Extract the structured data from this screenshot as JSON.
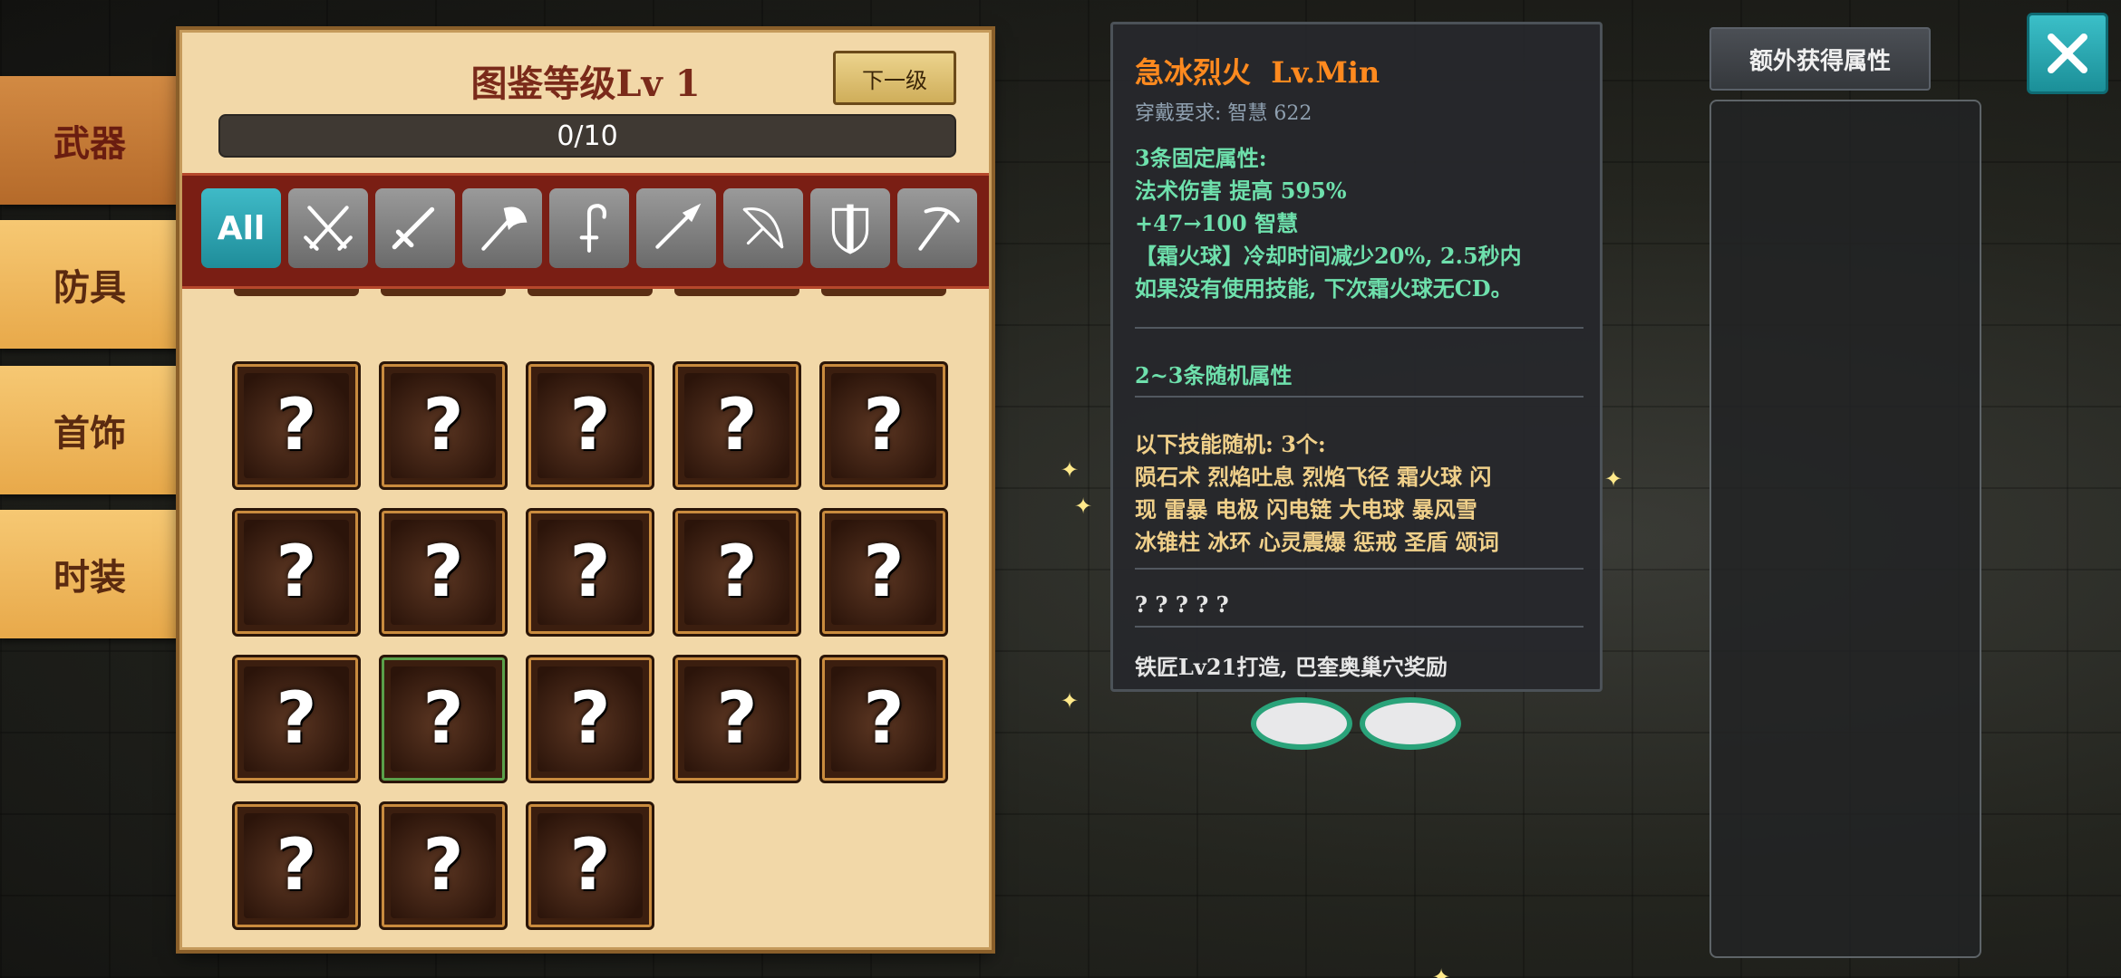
{
  "tabs": [
    {
      "label": "武器",
      "active": true
    },
    {
      "label": "防具",
      "active": false
    },
    {
      "label": "首饰",
      "active": false
    },
    {
      "label": "时装",
      "active": false
    }
  ],
  "codex": {
    "title": "图鉴等级Lv 1",
    "next_button": "下一级",
    "progress_text": "0/10",
    "progress_fraction": 0
  },
  "filters": [
    {
      "label": "All",
      "icon": "all-icon",
      "active": true
    },
    {
      "icon": "dual-swords-icon"
    },
    {
      "icon": "sword-icon"
    },
    {
      "icon": "axe-icon"
    },
    {
      "icon": "hook-icon"
    },
    {
      "icon": "spear-icon"
    },
    {
      "icon": "bow-icon"
    },
    {
      "icon": "shield-sword-icon"
    },
    {
      "icon": "scythe-icon"
    }
  ],
  "grid": {
    "slot_text": "?",
    "slots": [
      {
        "icon": "shield-icon"
      },
      {
        "icon": "axe-icon"
      },
      {
        "icon": "spear-icon"
      },
      {
        "icon": "scythe-icon"
      },
      {
        "icon": "crescent-blade-icon"
      },
      {
        "icon": "battle-axe-icon"
      },
      {
        "icon": "staff-icon"
      },
      {
        "icon": "armor-icon"
      },
      {
        "icon": "hammer-icon"
      },
      {
        "icon": "halberd-icon"
      },
      {
        "icon": "sickle-icon"
      },
      {
        "icon": "mace-icon",
        "selected": true
      },
      {
        "icon": "greatsword-icon"
      },
      {
        "icon": "scythe-icon"
      },
      {
        "icon": "glaive-icon"
      },
      {
        "icon": "spiked-shield-icon"
      },
      {
        "icon": "crescent-spear-icon"
      },
      {
        "icon": "blade-icon"
      }
    ]
  },
  "tooltip": {
    "name": "急冰烈火",
    "level": "Lv.Min",
    "requirement_label": "穿戴要求:",
    "requirement_value": "智慧 622",
    "fixed_header": "3条固定属性:",
    "fixed_lines": [
      "法术伤害 提高 595%",
      "+47→100 智慧",
      "【霜火球】冷却时间减少20%, 2.5秒内",
      "如果没有使用技能, 下次霜火球无CD。"
    ],
    "random_header": "2~3条随机属性",
    "skills_header": "以下技能随机: 3个:",
    "skills_lines": [
      "陨石术 烈焰吐息 烈焰飞径 霜火球 闪",
      "现 雷暴 电极 闪电链 大电球 暴风雪",
      "冰锥柱 冰环 心灵震爆 惩戒 圣盾 颂词"
    ],
    "unknown": "? ? ? ? ?",
    "source": "铁匠Lv21打造, 巴奎奥巢穴奖励"
  },
  "extra": {
    "button_label": "额外获得属性"
  },
  "colors": {
    "accent_teal": "#2aa8b4",
    "tooltip_title": "#ff8a1f",
    "tooltip_green": "#6ee0ac",
    "tooltip_yellow": "#f0d08a"
  }
}
